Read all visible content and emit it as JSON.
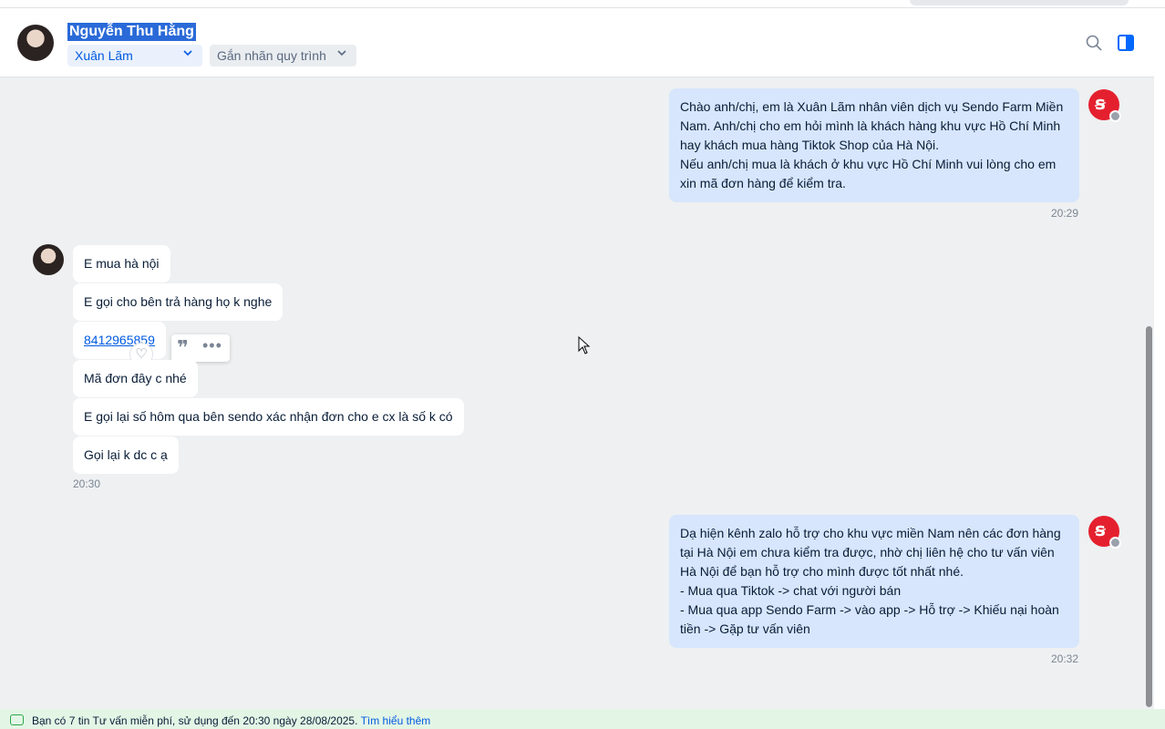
{
  "header": {
    "contact_name": "Nguyễn Thu Hằng",
    "assignee": "Xuân Lãm",
    "flow_label": "Gắn nhãn quy trình",
    "icons": [
      "search-icon",
      "sidebar-toggle-icon",
      "chevron-down-icon"
    ]
  },
  "messages": {
    "m1": "Chào anh/chị, em là Xuân Lãm nhân viên dịch vụ Sendo Farm Miền Nam. Anh/chị cho em hỏi mình là khách hàng khu vực Hồ Chí Minh hay khách mua hàng Tiktok Shop của Hà Nội.",
    "m1b": "Nếu anh/chị mua là khách ở khu vực Hồ Chí Minh vui lòng cho em xin mã đơn hàng để kiểm tra.",
    "t1": "20:29",
    "c1": "E mua hà nội",
    "c2": "E gọi cho bên trả hàng họ k nghe",
    "c3": "8412965859",
    "c4": "Mã đơn đây c nhé",
    "c5": "E gọi lại số hôm qua bên sendo xác nhận đơn cho e cx là số k có",
    "c6": "Gọi lại k dc c ạ",
    "t2": "20:30",
    "m2l1": "Dạ hiện kênh zalo hỗ trợ cho khu vực miền Nam nên các đơn hàng tại Hà Nội em chưa kiểm tra được, nhờ chị liên hệ cho tư vấn viên Hà Nội để bạn hỗ trợ cho mình được tốt nhất nhé.",
    "m2l2": "- Mua qua Tiktok -> chat với người bán",
    "m2l3": "- Mua qua app Sendo Farm -> vào app -> Hỗ trợ -> Khiếu nại hoàn tiền -> Gặp tư vấn viên",
    "t3": "20:32"
  },
  "footer": {
    "notice": "Bạn có 7 tin Tư vấn miễn phí, sử dụng đến 20:30 ngày 28/08/2025.",
    "link": "Tìm hiểu thêm"
  },
  "colors": {
    "accent": "#0068ff",
    "my_bubble": "#d7e6fc",
    "brand_red": "#e5202e",
    "footer_bg": "#e3f6e6"
  }
}
